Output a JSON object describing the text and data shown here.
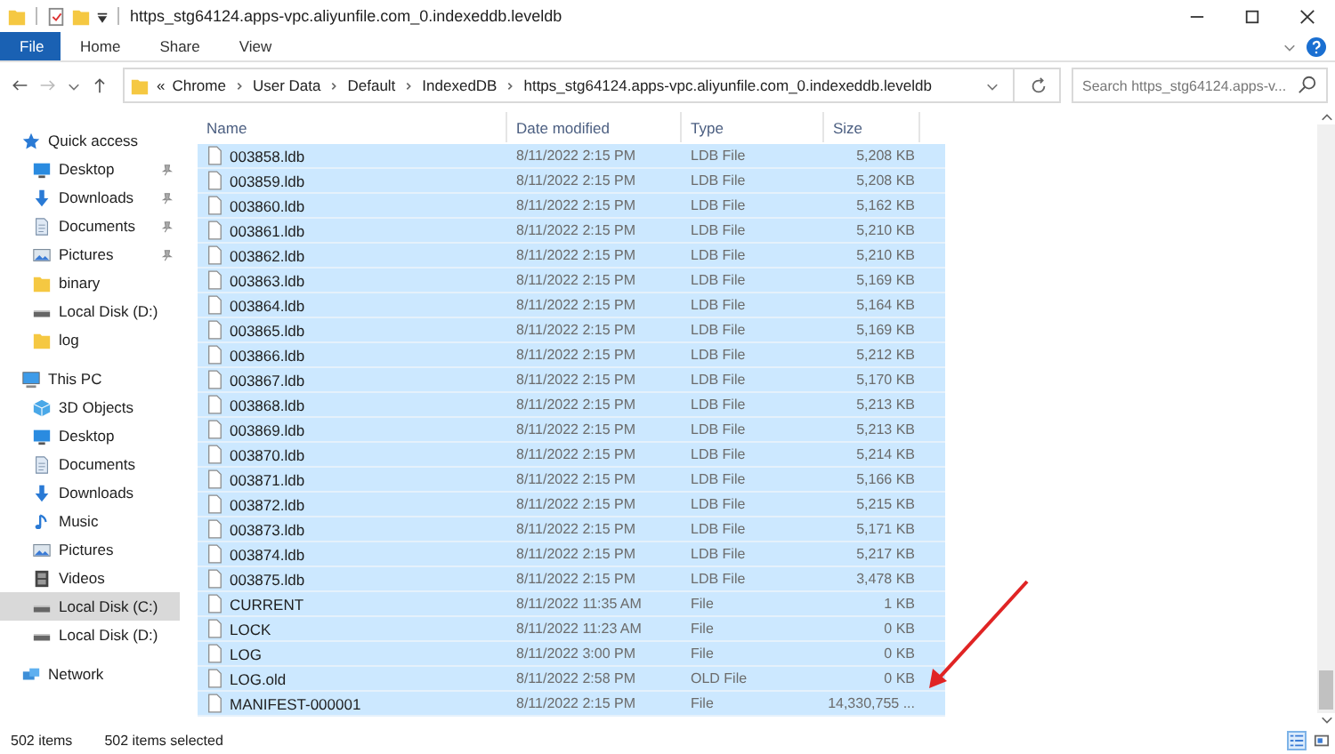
{
  "window": {
    "title": "https_stg64124.apps-vpc.aliyunfile.com_0.indexeddb.leveldb"
  },
  "ribbon_tabs": [
    {
      "label": "File",
      "selected": true
    },
    {
      "label": "Home",
      "selected": false
    },
    {
      "label": "Share",
      "selected": false
    },
    {
      "label": "View",
      "selected": false
    }
  ],
  "address_bar": {
    "overflow": "«",
    "crumbs": [
      "Chrome",
      "User Data",
      "Default",
      "IndexedDB",
      "https_stg64124.apps-vpc.aliyunfile.com_0.indexeddb.leveldb"
    ]
  },
  "search": {
    "placeholder": "Search https_stg64124.apps-v..."
  },
  "sidebar": {
    "items": [
      {
        "label": "Quick access",
        "kind": "star",
        "selected": false,
        "children": [
          {
            "label": "Desktop",
            "kind": "desktop",
            "pinned": true,
            "selected": false
          },
          {
            "label": "Downloads",
            "kind": "download",
            "pinned": true,
            "selected": false
          },
          {
            "label": "Documents",
            "kind": "document",
            "pinned": true,
            "selected": false
          },
          {
            "label": "Pictures",
            "kind": "picture",
            "pinned": true,
            "selected": false
          },
          {
            "label": "binary",
            "kind": "folder",
            "pinned": false,
            "selected": false
          },
          {
            "label": "Local Disk (D:)",
            "kind": "drive",
            "pinned": false,
            "selected": false
          },
          {
            "label": "log",
            "kind": "folder",
            "pinned": false,
            "selected": false
          }
        ]
      },
      {
        "label": "This PC",
        "kind": "pc",
        "selected": false,
        "children": [
          {
            "label": "3D Objects",
            "kind": "cube",
            "selected": false
          },
          {
            "label": "Desktop",
            "kind": "desktop",
            "selected": false
          },
          {
            "label": "Documents",
            "kind": "document",
            "selected": false
          },
          {
            "label": "Downloads",
            "kind": "download",
            "selected": false
          },
          {
            "label": "Music",
            "kind": "music",
            "selected": false
          },
          {
            "label": "Pictures",
            "kind": "picture",
            "selected": false
          },
          {
            "label": "Videos",
            "kind": "video",
            "selected": false
          },
          {
            "label": "Local Disk (C:)",
            "kind": "drive",
            "selected": true
          },
          {
            "label": "Local Disk (D:)",
            "kind": "drive",
            "selected": false
          }
        ]
      },
      {
        "label": "Network",
        "kind": "network",
        "selected": false
      }
    ]
  },
  "table": {
    "columns": [
      "Name",
      "Date modified",
      "Type",
      "Size"
    ],
    "rows": [
      {
        "name": "003858.ldb",
        "date": "8/11/2022 2:15 PM",
        "type": "LDB File",
        "size": "5,208 KB",
        "selected": true
      },
      {
        "name": "003859.ldb",
        "date": "8/11/2022 2:15 PM",
        "type": "LDB File",
        "size": "5,208 KB",
        "selected": true
      },
      {
        "name": "003860.ldb",
        "date": "8/11/2022 2:15 PM",
        "type": "LDB File",
        "size": "5,162 KB",
        "selected": true
      },
      {
        "name": "003861.ldb",
        "date": "8/11/2022 2:15 PM",
        "type": "LDB File",
        "size": "5,210 KB",
        "selected": true
      },
      {
        "name": "003862.ldb",
        "date": "8/11/2022 2:15 PM",
        "type": "LDB File",
        "size": "5,210 KB",
        "selected": true
      },
      {
        "name": "003863.ldb",
        "date": "8/11/2022 2:15 PM",
        "type": "LDB File",
        "size": "5,169 KB",
        "selected": true
      },
      {
        "name": "003864.ldb",
        "date": "8/11/2022 2:15 PM",
        "type": "LDB File",
        "size": "5,164 KB",
        "selected": true
      },
      {
        "name": "003865.ldb",
        "date": "8/11/2022 2:15 PM",
        "type": "LDB File",
        "size": "5,169 KB",
        "selected": true
      },
      {
        "name": "003866.ldb",
        "date": "8/11/2022 2:15 PM",
        "type": "LDB File",
        "size": "5,212 KB",
        "selected": true
      },
      {
        "name": "003867.ldb",
        "date": "8/11/2022 2:15 PM",
        "type": "LDB File",
        "size": "5,170 KB",
        "selected": true
      },
      {
        "name": "003868.ldb",
        "date": "8/11/2022 2:15 PM",
        "type": "LDB File",
        "size": "5,213 KB",
        "selected": true
      },
      {
        "name": "003869.ldb",
        "date": "8/11/2022 2:15 PM",
        "type": "LDB File",
        "size": "5,213 KB",
        "selected": true
      },
      {
        "name": "003870.ldb",
        "date": "8/11/2022 2:15 PM",
        "type": "LDB File",
        "size": "5,214 KB",
        "selected": true
      },
      {
        "name": "003871.ldb",
        "date": "8/11/2022 2:15 PM",
        "type": "LDB File",
        "size": "5,166 KB",
        "selected": true
      },
      {
        "name": "003872.ldb",
        "date": "8/11/2022 2:15 PM",
        "type": "LDB File",
        "size": "5,215 KB",
        "selected": true
      },
      {
        "name": "003873.ldb",
        "date": "8/11/2022 2:15 PM",
        "type": "LDB File",
        "size": "5,171 KB",
        "selected": true
      },
      {
        "name": "003874.ldb",
        "date": "8/11/2022 2:15 PM",
        "type": "LDB File",
        "size": "5,217 KB",
        "selected": true
      },
      {
        "name": "003875.ldb",
        "date": "8/11/2022 2:15 PM",
        "type": "LDB File",
        "size": "3,478 KB",
        "selected": true
      },
      {
        "name": "CURRENT",
        "date": "8/11/2022 11:35 AM",
        "type": "File",
        "size": "1 KB",
        "selected": true
      },
      {
        "name": "LOCK",
        "date": "8/11/2022 11:23 AM",
        "type": "File",
        "size": "0 KB",
        "selected": true
      },
      {
        "name": "LOG",
        "date": "8/11/2022 3:00 PM",
        "type": "File",
        "size": "0 KB",
        "selected": true
      },
      {
        "name": "LOG.old",
        "date": "8/11/2022 2:58 PM",
        "type": "OLD File",
        "size": "0 KB",
        "selected": true
      },
      {
        "name": "MANIFEST-000001",
        "date": "8/11/2022 2:15 PM",
        "type": "File",
        "size": "14,330,755 ...",
        "selected": true
      }
    ]
  },
  "status_bar": {
    "item_count": "502 items",
    "selection": "502 items selected"
  }
}
